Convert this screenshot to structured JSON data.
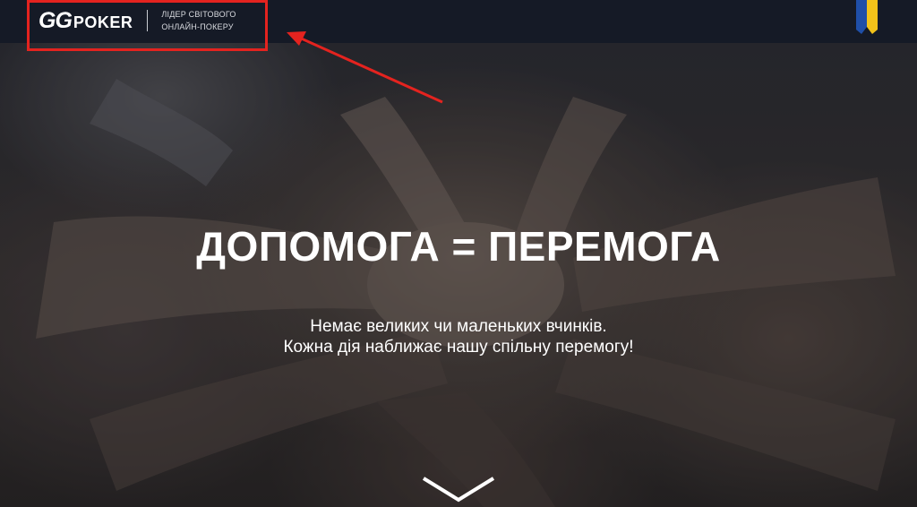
{
  "header": {
    "logo": {
      "gg": "GG",
      "poker": "POKER"
    },
    "tagline_line1": "ЛІДЕР СВІТОВОГО",
    "tagline_line2": "ОНЛАЙН-ПОКЕРУ"
  },
  "hero": {
    "headline": "ДОПОМОГА = ПЕРЕМОГА",
    "subtext_line1": "Немає великих чи маленьких вчинків.",
    "subtext_line2": "Кожна дія наближає нашу спільну перемогу!"
  },
  "icons": {
    "ribbon": "ukraine-ribbon-icon",
    "scroll": "chevron-down-icon",
    "annotation_arrow": "red-arrow-annotation"
  },
  "colors": {
    "header_bg": "#151a26",
    "highlight": "#e4231f",
    "ribbon_blue": "#1f4fa8",
    "ribbon_yellow": "#f2c21a"
  }
}
